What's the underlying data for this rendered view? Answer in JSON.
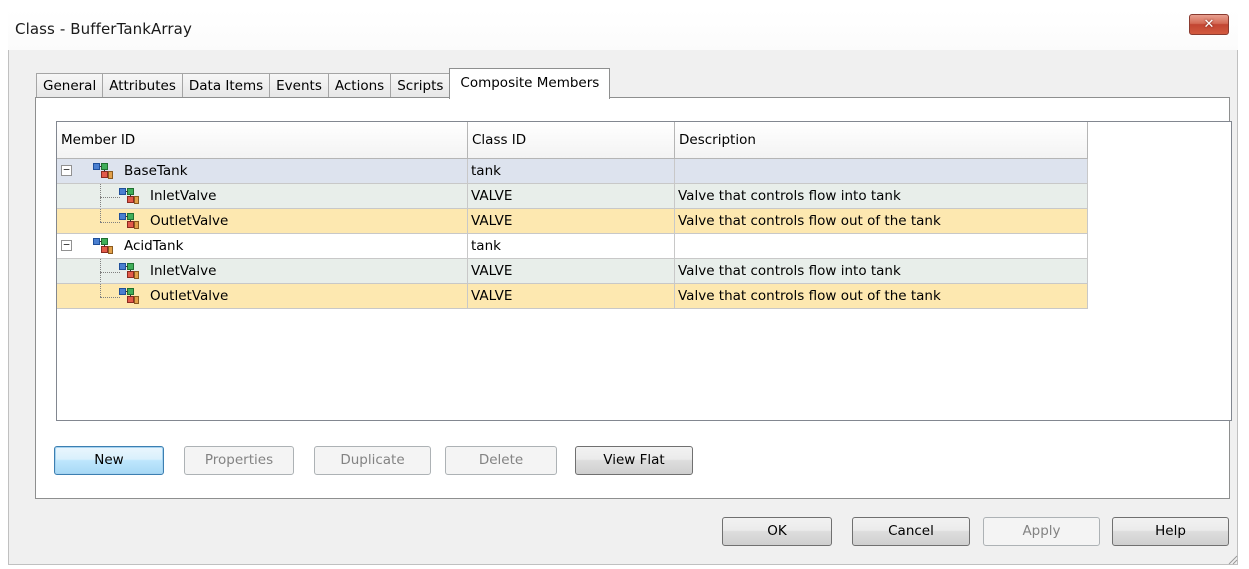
{
  "window": {
    "title": "Class - BufferTankArray",
    "close_label": "✕"
  },
  "tabs": [
    {
      "label": "General"
    },
    {
      "label": "Attributes"
    },
    {
      "label": "Data Items"
    },
    {
      "label": "Events"
    },
    {
      "label": "Actions"
    },
    {
      "label": "Scripts"
    },
    {
      "label": "Composite Members",
      "active": true
    }
  ],
  "grid": {
    "columns": [
      "Member ID",
      "Class ID",
      "Description"
    ],
    "rows": [
      {
        "member_id": "BaseTank",
        "class_id": "tank",
        "description": "",
        "level": 0,
        "expander": "−"
      },
      {
        "member_id": "InletValve",
        "class_id": "VALVE",
        "description": "Valve that controls flow into tank",
        "level": 1
      },
      {
        "member_id": "OutletValve",
        "class_id": "VALVE",
        "description": "Valve that controls flow out of the tank",
        "level": 1
      },
      {
        "member_id": "AcidTank",
        "class_id": "tank",
        "description": "",
        "level": 0,
        "expander": "−"
      },
      {
        "member_id": "InletValve",
        "class_id": "VALVE",
        "description": "Valve that controls flow into tank",
        "level": 1
      },
      {
        "member_id": "OutletValve",
        "class_id": "VALVE",
        "description": "Valve that controls flow out of the tank",
        "level": 1
      }
    ]
  },
  "panel_buttons": {
    "new": "New",
    "properties": "Properties",
    "duplicate": "Duplicate",
    "delete": "Delete",
    "view_flat": "View Flat"
  },
  "dialog_buttons": {
    "ok": "OK",
    "cancel": "Cancel",
    "apply": "Apply",
    "help": "Help"
  },
  "colors": {
    "close_button": "#c24532",
    "row_parent_selected": "#dde3ee",
    "row_child": "#e8eeea",
    "row_highlight": "#fde8b0",
    "default_button": "#bee6fd"
  },
  "icons": {
    "component": "component-icon",
    "expander": "collapse-icon",
    "close": "close-icon"
  }
}
